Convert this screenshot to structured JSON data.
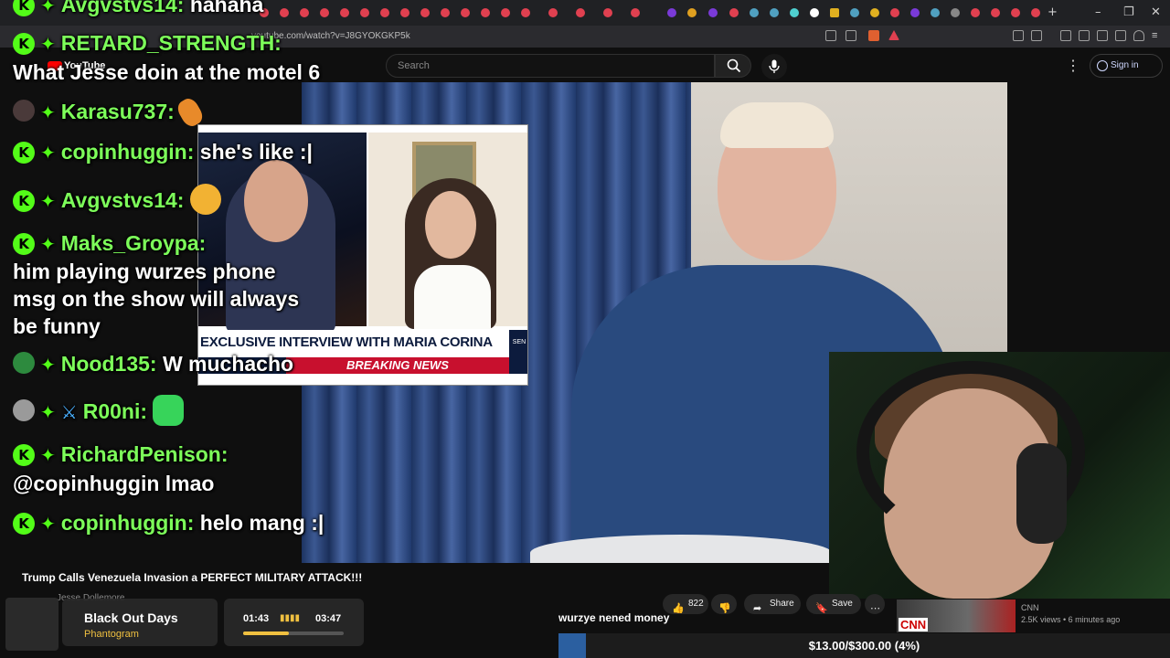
{
  "browser": {
    "url": "youtube.com/watch?v=J8GYOKGKP5k"
  },
  "youtube": {
    "logo_text": "YouTube",
    "search_placeholder": "Search",
    "signin_label": "Sign in",
    "video_title": "Trump Calls Venezuela Invasion a PERFECT MILITARY ATTACK!!!",
    "channel_name_partial": "Jesse Dollemore",
    "like_count": "822",
    "share_label": "Share",
    "save_label": "Save"
  },
  "news_clip": {
    "headline": "EXCLUSIVE INTERVIEW WITH MARIA CORINA MACHADO",
    "banner": "BREAKING NEWS",
    "logo_text": "SEN"
  },
  "chat": [
    {
      "user": "Avgvstvs14:",
      "text": "hahaha",
      "badge": "kick"
    },
    {
      "user": "RETARD_STRENGTH:",
      "text": "",
      "badge": "kick"
    },
    {
      "user": "",
      "text": "What Jesse doin at the motel 6",
      "badge": "none"
    },
    {
      "user": "Karasu737:",
      "text": "",
      "badge": "avatar",
      "emote_color": "#e88a2a"
    },
    {
      "user": "copinhuggin:",
      "text": "she's like :|",
      "badge": "kick"
    },
    {
      "user": "Avgvstvs14:",
      "text": "",
      "badge": "kick",
      "emote_color": "#f2b233"
    },
    {
      "user": "Maks_Groypa:",
      "text": "",
      "badge": "kick"
    },
    {
      "user": "",
      "text": "him playing wurzes phone msg on the show will always be funny",
      "badge": "none"
    },
    {
      "user": "Nood135:",
      "text": "W muchacho",
      "badge": "avatar-green"
    },
    {
      "user": "R00ni:",
      "text": "",
      "badge": "avatar-grey",
      "emote_color": "#37d45a"
    },
    {
      "user": "RichardPenison:",
      "text": "",
      "badge": "kick"
    },
    {
      "user": "",
      "text": "@copinhuggin lmao",
      "badge": "none"
    },
    {
      "user": "copinhuggin:",
      "text": "helo mang :|",
      "badge": "kick"
    }
  ],
  "now_playing": {
    "title": "Black Out Days",
    "artist": "Phantogram",
    "current_time": "01:43",
    "duration": "03:47",
    "progress": 0.45
  },
  "overlay_text": "wurzye nened money",
  "recommended": {
    "channel": "CNN",
    "meta": "2.5K views • 6 minutes ago",
    "thumb_text": "CNN"
  },
  "donation_goal": {
    "text": "$13.00/$300.00 (4%)",
    "progress": 0.04
  },
  "colors": {
    "chat_username": "#7dff5a",
    "kick_green": "#53fc18",
    "youtube_red": "#ff0000",
    "fox_red": "#c8102e"
  }
}
